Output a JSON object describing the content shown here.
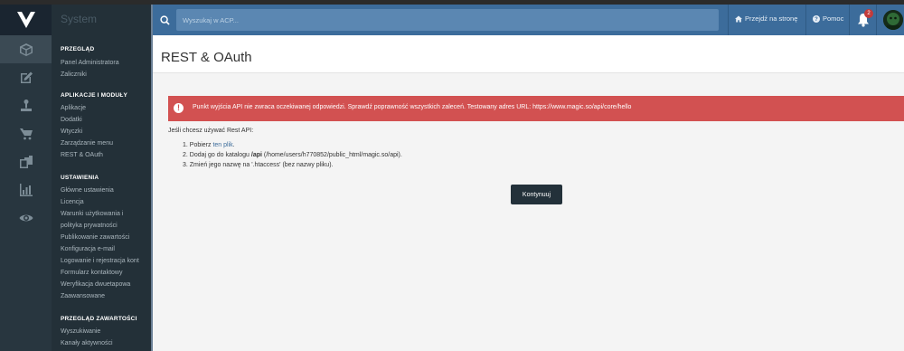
{
  "app": {
    "title": "System"
  },
  "header": {
    "search_placeholder": "Wyszukaj w ACP...",
    "visit_site": "Przejdź na stronę",
    "help": "Pomoc",
    "notification_count": "2"
  },
  "sidebar": {
    "sections": [
      {
        "title": "PRZEGLĄD",
        "items": [
          "Panel Administratora",
          "Zaliczniki"
        ]
      },
      {
        "title": "APLIKACJE I MODUŁY",
        "items": [
          "Aplikacje",
          "Dodatki",
          "Wtyczki",
          "Zarządzanie menu",
          "REST & OAuth"
        ]
      },
      {
        "title": "USTAWIENIA",
        "items": [
          "Główne ustawienia",
          "Licencja",
          "Warunki użytkowania i",
          "polityka prywatności",
          "Publikowanie zawartości",
          "Konfiguracja e-mail",
          "Logowanie i rejestracja kont",
          "Formularz kontaktowy",
          "Weryfikacja dwuetapowa",
          "Zaawansowane"
        ]
      },
      {
        "title": "PRZEGLĄD ZAWARTOŚCI",
        "items": [
          "Wyszukiwanie",
          "Kanały aktywności"
        ]
      }
    ]
  },
  "rail_icons": [
    "cube-icon",
    "edit-icon",
    "joystick-icon",
    "cart-icon",
    "clone-icon",
    "bar-chart-icon",
    "eye-icon"
  ],
  "content": {
    "page_title": "REST & OAuth",
    "alert": "Punkt wyjścia API nie zwraca oczekiwanej odpowiedzi. Sprawdź poprawność wszystkich zaleceń. Testowany adres URL: https://www.magic.so/api/core/hello",
    "intro": "Jeśli chcesz używać Rest API:",
    "step1_prefix": "1. Pobierz ",
    "step1_link": "ten plik",
    "step1_suffix": ".",
    "step2_prefix": "2. Dodaj go do katalogu ",
    "step2_bold": "/api",
    "step2_suffix": " (/home/users/h770852/public_html/magic.so/api).",
    "step3": "3. Zmień jego nazwę na '.htaccess' (bez nazwy pliku).",
    "continue_button": "Kontynuuj"
  },
  "colors": {
    "header": "#3c6c9b",
    "sidebar": "#233038",
    "alert": "#d25151",
    "button": "#23313a"
  }
}
